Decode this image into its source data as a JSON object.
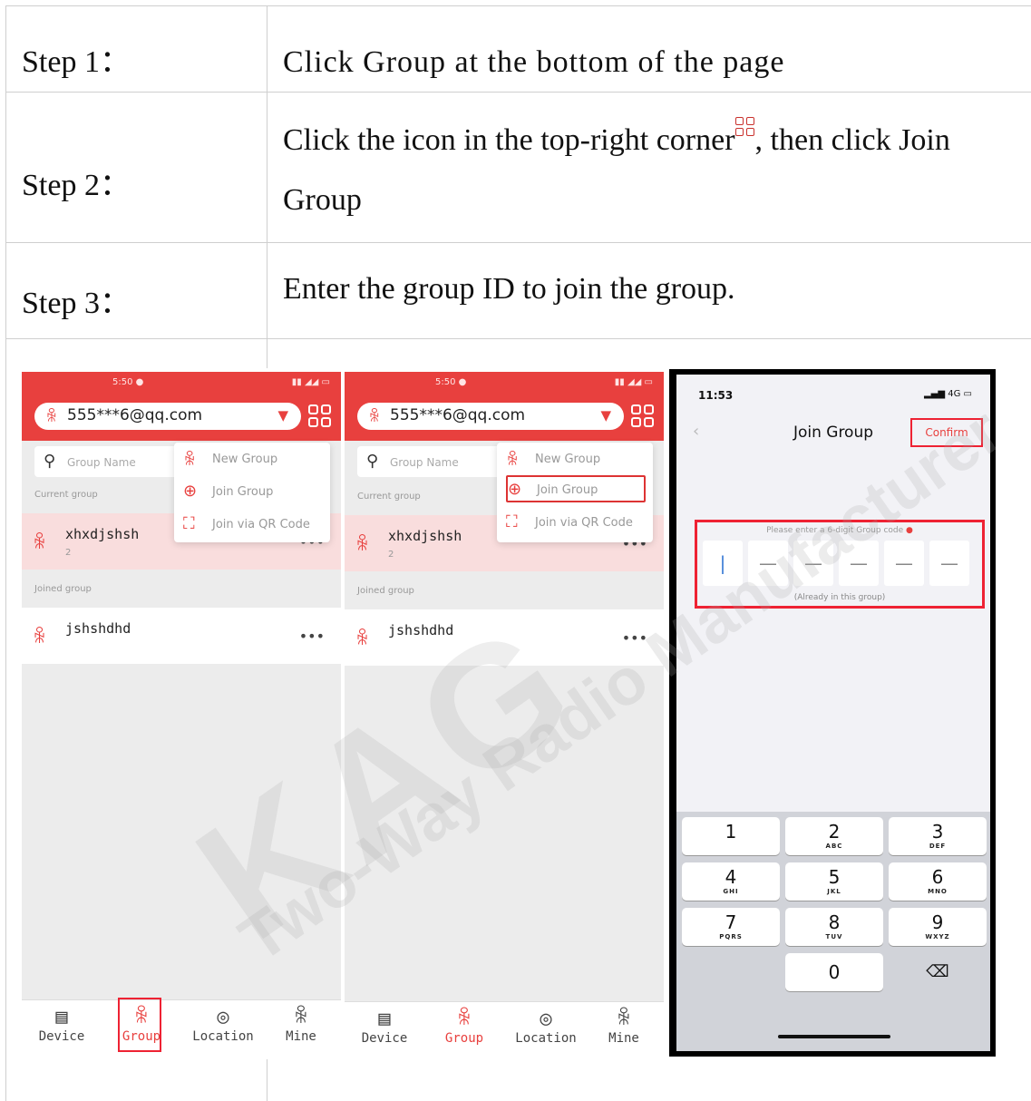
{
  "steps": [
    {
      "label": "Step 1：",
      "text": "Click Group at the bottom of the page"
    },
    {
      "label": "Step 2：",
      "text_before_icon": "Click the icon in the top-right corner",
      "text_after_icon": ", then click Join",
      "text_line2": "Group"
    },
    {
      "label": "Step 3：",
      "text": "Enter the group ID to join the group."
    }
  ],
  "inline_icon": "grid-icon",
  "phone_common": {
    "account": "555***6@qq.com",
    "search_placeholder": "Group Name",
    "current_group_label": "Current group",
    "joined_group_label": "Joined group",
    "current_group_name": "xhxdjshsh",
    "current_group_sub": "2",
    "joined_group_name": "jshshdhd",
    "more": "•••",
    "menu": [
      "New Group",
      "Join Group",
      "Join via QR Code"
    ],
    "tabs": [
      "Device",
      "Group",
      "Location",
      "Mine"
    ],
    "active_tab": "Group"
  },
  "phone3": {
    "time": "11:53",
    "signal": "4G",
    "title": "Join Group",
    "confirm": "Confirm",
    "hint": "Please enter a 6-digit Group code",
    "cells": [
      "|",
      "—",
      "—",
      "—",
      "—",
      "—"
    ],
    "note": "(Already in this group)",
    "keys": [
      {
        "n": "1",
        "s": ""
      },
      {
        "n": "2",
        "s": "ABC"
      },
      {
        "n": "3",
        "s": "DEF"
      },
      {
        "n": "4",
        "s": "GHI"
      },
      {
        "n": "5",
        "s": "JKL"
      },
      {
        "n": "6",
        "s": "MNO"
      },
      {
        "n": "7",
        "s": "PQRS"
      },
      {
        "n": "8",
        "s": "TUV"
      },
      {
        "n": "9",
        "s": "WXYZ"
      },
      {
        "n": "0",
        "s": ""
      }
    ],
    "delete_icon": "backspace-icon"
  },
  "watermark": {
    "brand": "KAG",
    "tagline": "Two-Way Radio Manufacturer"
  },
  "colors": {
    "accent": "#e8403e",
    "highlight_box": "#e22233"
  }
}
